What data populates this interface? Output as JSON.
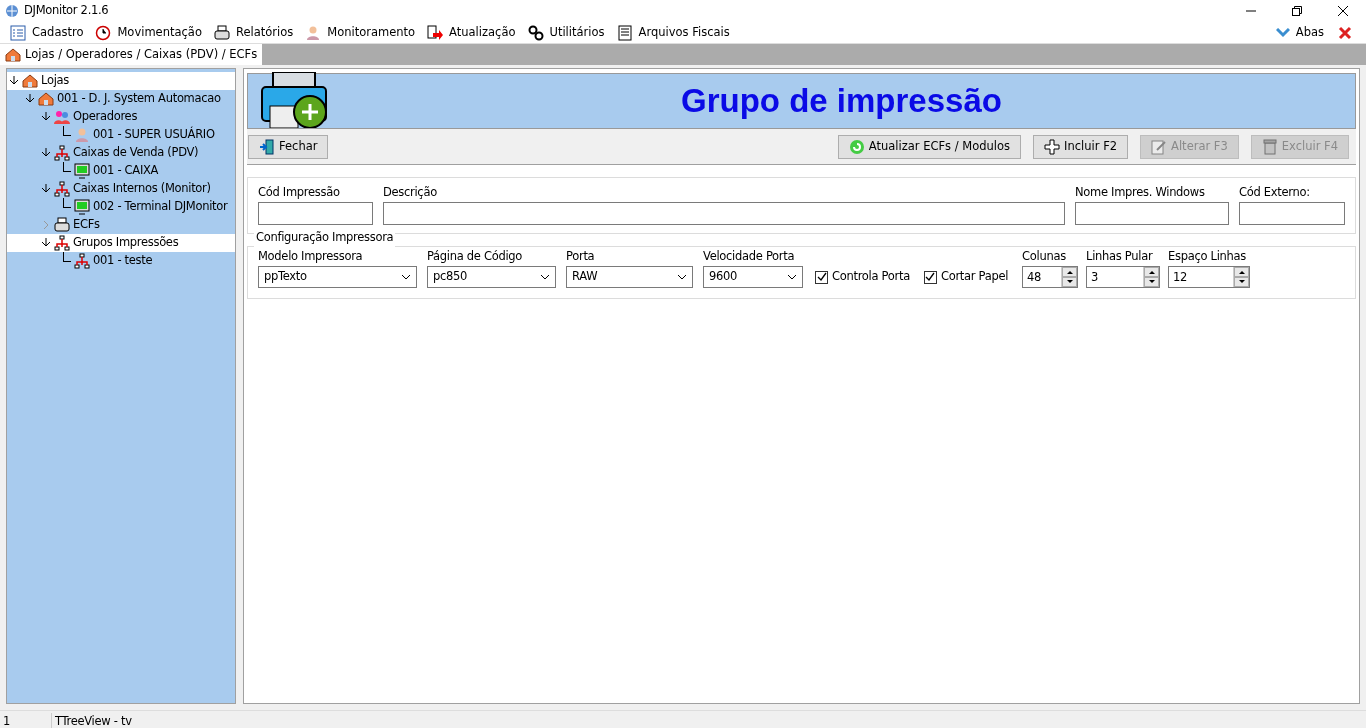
{
  "window": {
    "title": "DJMonitor 2.1.6"
  },
  "menu": [
    {
      "label": "Cadastro"
    },
    {
      "label": "Movimentação"
    },
    {
      "label": "Relatórios"
    },
    {
      "label": "Monitoramento"
    },
    {
      "label": "Atualização"
    },
    {
      "label": "Utilitários"
    },
    {
      "label": "Arquivos Fiscais"
    }
  ],
  "menu_right": {
    "label": "Abas"
  },
  "tabs": [
    {
      "label": "Lojas / Operadores / Caixas (PDV) / ECFs",
      "selected": true
    }
  ],
  "tree": [
    {
      "label": "Lojas",
      "kind": "store",
      "shaded": false,
      "expanded": true,
      "children": [
        {
          "label": "001 - D. J. System Automacao",
          "kind": "store",
          "shaded": true,
          "expanded": true,
          "children": [
            {
              "label": "Operadores",
              "kind": "users",
              "shaded": true,
              "expanded": true,
              "children": [
                {
                  "label": "001 - SUPER USUÁRIO",
                  "kind": "user",
                  "shaded": true
                }
              ]
            },
            {
              "label": "Caixas de Venda (PDV)",
              "kind": "network",
              "shaded": true,
              "expanded": true,
              "children": [
                {
                  "label": "001 - CAIXA",
                  "kind": "terminal",
                  "shaded": true
                }
              ]
            },
            {
              "label": "Caixas Internos (Monitor)",
              "kind": "network",
              "shaded": true,
              "expanded": true,
              "children": [
                {
                  "label": "002 - Terminal DJMonitor",
                  "kind": "terminal",
                  "shaded": true
                }
              ]
            },
            {
              "label": "ECFs",
              "kind": "printer",
              "shaded": true,
              "expanded": false
            },
            {
              "label": "Grupos Impressões",
              "kind": "network",
              "shaded": false,
              "expanded": true,
              "children": [
                {
                  "label": "001 - teste",
                  "kind": "network",
                  "shaded": true
                }
              ]
            }
          ]
        }
      ]
    }
  ],
  "header": {
    "title": "Grupo de impressão"
  },
  "toolbar": [
    {
      "label": "Fechar",
      "disabled": false
    },
    {
      "label": "Atualizar ECFs / Modulos",
      "disabled": false
    },
    {
      "label": "Incluir F2",
      "disabled": false
    },
    {
      "label": "Alterar F3",
      "disabled": true
    },
    {
      "label": "Excluir F4",
      "disabled": true
    }
  ],
  "fields": [
    {
      "label": "Cód Impressão"
    },
    {
      "label": "Descrição"
    },
    {
      "label": "Nome Impres. Windows"
    },
    {
      "label": "Cód Externo:"
    }
  ],
  "printer_config": {
    "title": "Configuração Impressora",
    "controls": [
      {
        "kind": "select",
        "label": "Modelo Impressora",
        "value": "ppTexto"
      },
      {
        "kind": "select",
        "label": "Página de Código",
        "value": "pc850"
      },
      {
        "kind": "select",
        "label": "Porta",
        "value": "RAW"
      },
      {
        "kind": "select",
        "label": "Velocidade Porta",
        "value": "9600"
      },
      {
        "kind": "checkbox",
        "label": "Controla Porta",
        "checked": true
      },
      {
        "kind": "checkbox",
        "label": "Cortar Papel",
        "checked": true
      },
      {
        "kind": "spin",
        "label": "Colunas",
        "value": "48"
      },
      {
        "kind": "spin",
        "label": "Linhas Pular",
        "value": "3"
      },
      {
        "kind": "spin",
        "label": "Espaço Linhas",
        "value": "12"
      }
    ]
  },
  "status_bar": [
    "1",
    "TTreeView - tv"
  ]
}
